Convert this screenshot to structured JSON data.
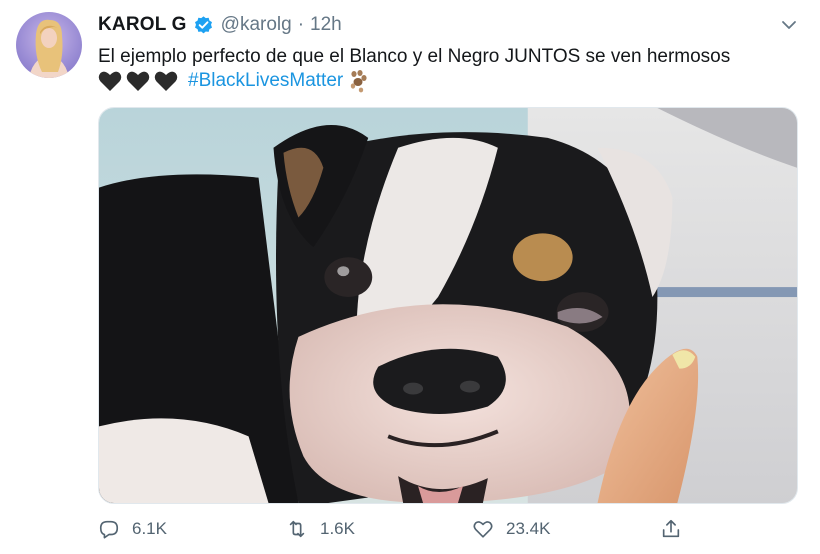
{
  "tweet": {
    "author_name": "KAROL G",
    "handle": "@karolg",
    "separator": "·",
    "time": "12h",
    "text_line1": "El ejemplo perfecto de que el Blanco y el Negro JUNTOS se ven hermosos",
    "hashtag": "#BlackLivesMatter",
    "emoji_hearts": [
      "black-heart-icon",
      "black-heart-icon",
      "black-heart-icon"
    ],
    "emoji_end": "paw-prints-icon",
    "media": {
      "alt_subject": "black-and-white-bulldog-photo"
    },
    "stats": {
      "replies": "6.1K",
      "retweets": "1.6K",
      "likes": "23.4K"
    }
  },
  "colors": {
    "link": "#1b95e0",
    "muted": "#657786",
    "verified": "#1da1f2"
  },
  "icons": {
    "reply": "reply-icon",
    "retweet": "retweet-icon",
    "like": "like-icon",
    "share": "share-icon",
    "more": "chevron-down-icon",
    "verified": "verified-badge-icon"
  }
}
